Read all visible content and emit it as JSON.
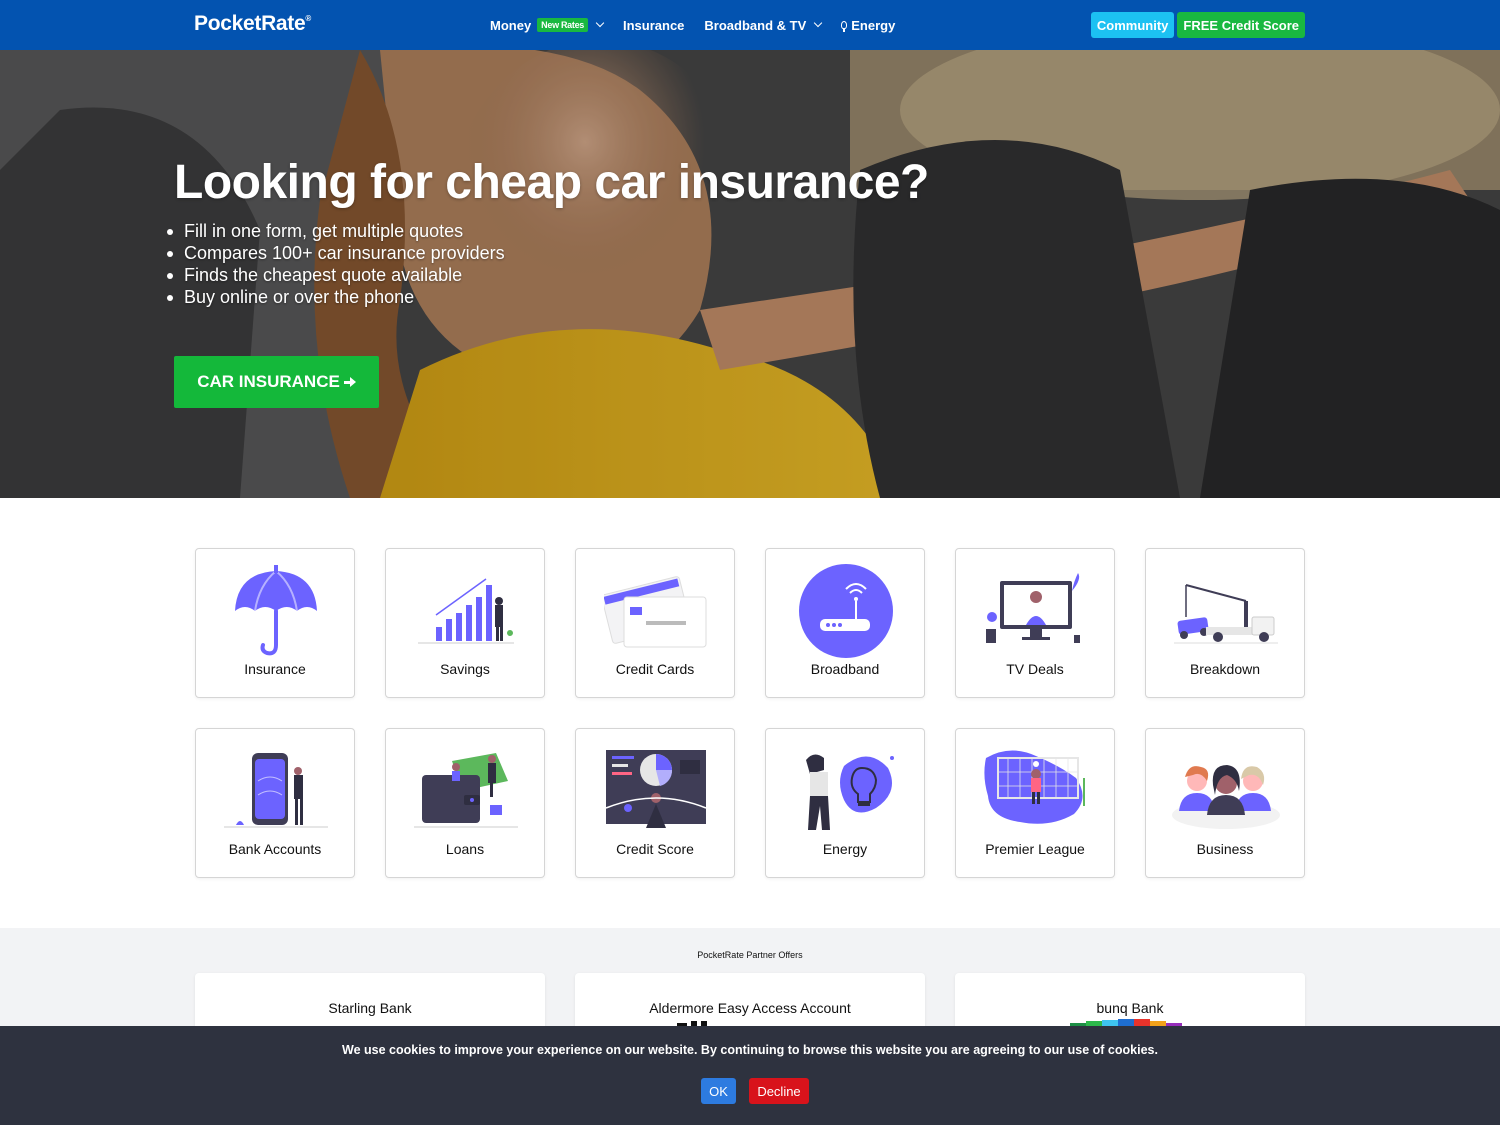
{
  "nav": {
    "brand": "PocketRate",
    "brand_mark": "®",
    "items": [
      {
        "label": "Money",
        "badge": "New Rates",
        "dropdown": true
      },
      {
        "label": "Insurance",
        "dropdown": false
      },
      {
        "label": "Broadband & TV",
        "dropdown": true
      },
      {
        "label": "Energy",
        "dropdown": false,
        "icon": "bulb-icon"
      }
    ],
    "community_label": "Community",
    "credit_score_label": "FREE Credit Score"
  },
  "hero": {
    "title": "Looking for cheap car insurance?",
    "bullets": [
      "Fill in one form, get multiple quotes",
      "Compares 100+ car insurance providers",
      "Finds the cheapest quote available",
      "Buy online or over the phone"
    ],
    "cta_label": "CAR INSURANCE"
  },
  "categories": [
    {
      "label": "Insurance",
      "icon": "umbrella-icon"
    },
    {
      "label": "Savings",
      "icon": "growth-chart-icon"
    },
    {
      "label": "Credit Cards",
      "icon": "credit-cards-icon"
    },
    {
      "label": "Broadband",
      "icon": "router-icon"
    },
    {
      "label": "TV Deals",
      "icon": "monitor-icon"
    },
    {
      "label": "Breakdown",
      "icon": "tow-truck-icon"
    },
    {
      "label": "Bank Accounts",
      "icon": "phone-bank-icon"
    },
    {
      "label": "Loans",
      "icon": "wallet-icon"
    },
    {
      "label": "Credit Score",
      "icon": "dashboard-icon"
    },
    {
      "label": "Energy",
      "icon": "lightbulb-icon"
    },
    {
      "label": "Premier League",
      "icon": "football-goal-icon"
    },
    {
      "label": "Business",
      "icon": "team-icon"
    }
  ],
  "partners": {
    "title": "PocketRate Partner Offers",
    "cards": [
      {
        "name": "Starling Bank"
      },
      {
        "name": "Aldermore Easy Access Account"
      },
      {
        "name": "bunq Bank"
      }
    ]
  },
  "cookie": {
    "text": "We use cookies to improve your experience on our website. By continuing to browse this website you are agreeing to our use of cookies.",
    "ok_label": "OK",
    "decline_label": "Decline"
  },
  "colors": {
    "nav_bg": "#0353b0",
    "accent_green": "#19b840",
    "community_blue": "#1cc1f2",
    "illustration_purple": "#6c63ff",
    "cookie_bg": "#2e323f",
    "decline_red": "#d8131b",
    "ok_blue": "#2d7be0"
  }
}
